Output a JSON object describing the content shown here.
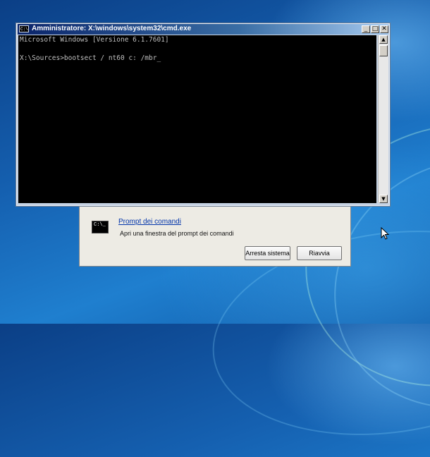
{
  "console": {
    "title": "Amministratore: X:\\windows\\system32\\cmd.exe",
    "icon_text": "C:\\",
    "minimize_label": "_",
    "maximize_label": "□",
    "close_label": "✕",
    "lines": [
      "Microsoft Windows [Versione 6.1.7601]",
      "X:\\Sources>bootsect / nt60 c: /mbr_"
    ],
    "scroll_up": "▲",
    "scroll_down": "▼"
  },
  "recovery": {
    "icon_text": "C:\\_",
    "link": "Prompt dei comandi",
    "description": "Apri una finestra del prompt dei comandi",
    "buttons": {
      "shutdown": "Arresta sistema",
      "restart": "Riavvia"
    }
  },
  "colors": {
    "desktop_bg": "#1560b0",
    "console_bg": "#000000",
    "console_text": "#c0c0c0",
    "title_bar": "#0a246a"
  }
}
